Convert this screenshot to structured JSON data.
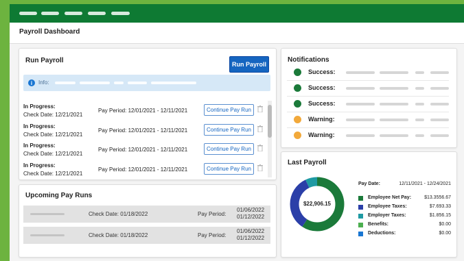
{
  "page": {
    "title": "Payroll Dashboard"
  },
  "run_payroll": {
    "title": "Run Payroll",
    "button_label": "Run Payroll",
    "info_label": "Info:",
    "continue_label": "Continue Pay Run",
    "rows": [
      {
        "status": "In Progress:",
        "check_date": "Check Date:  12/21/2021",
        "pay_period": "Pay Period: 12/01/2021 - 12/11/2021"
      },
      {
        "status": "In Progress:",
        "check_date": "Check Date:  12/21/2021",
        "pay_period": "Pay Period: 12/01/2021 - 12/11/2021"
      },
      {
        "status": "In Progress:",
        "check_date": "Check Date:  12/21/2021",
        "pay_period": "Pay Period: 12/01/2021 - 12/11/2021"
      },
      {
        "status": "In Progress:",
        "check_date": "Check Date:  12/21/2021",
        "pay_period": "Pay Period: 12/01/2021 - 12/11/2021"
      }
    ]
  },
  "upcoming": {
    "title": "Upcoming Pay Runs",
    "pay_period_label": "Pay Period:",
    "rows": [
      {
        "check_date": "Check Date: 01/18/2022",
        "period_start": "01/06/2022",
        "period_end": "01/12/2022"
      },
      {
        "check_date": "Check Date: 01/18/2022",
        "period_start": "01/06/2022",
        "period_end": "01/12/2022"
      }
    ]
  },
  "notifications": {
    "title": "Notifications",
    "items": [
      {
        "label": "Success:",
        "color": "#1b7a3a"
      },
      {
        "label": "Success:",
        "color": "#1b7a3a"
      },
      {
        "label": "Success:",
        "color": "#1b7a3a"
      },
      {
        "label": "Warning:",
        "color": "#f2a93b"
      },
      {
        "label": "Warning:",
        "color": "#f2a93b"
      }
    ]
  },
  "last_payroll": {
    "title": "Last Payroll",
    "pay_date_label": "Pay Date:",
    "pay_date_value": "12/11/2021 - 12/24/2021",
    "total": "$22,906.15",
    "chart_data": {
      "type": "pie",
      "categories": [
        "Employee Net Pay:",
        "Employee Taxes:",
        "Employer Taxes:",
        "Benefits:",
        "Deductions:"
      ],
      "values": [
        13556.67,
        7693.33,
        1656.15,
        0.0,
        0.0
      ],
      "labels": [
        "$13.3556.67",
        "$7.693.33",
        "$1.856.15",
        "$0.00",
        "$0.00"
      ],
      "colors": [
        "#1b7a3a",
        "#2b3fa8",
        "#1f9aa3",
        "#4caf50",
        "#1976d2"
      ]
    }
  },
  "colors": {
    "brand_green": "#0e7a33",
    "primary_blue": "#1565c0",
    "background_green": "#6db33f"
  }
}
